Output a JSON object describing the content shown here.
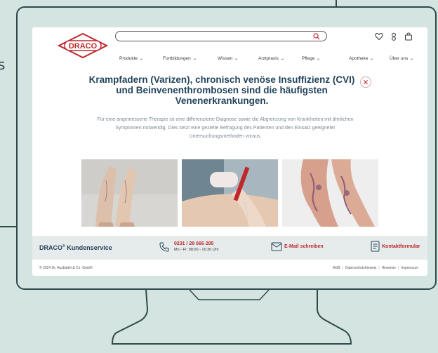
{
  "page": {
    "side_fragment": "s"
  },
  "header": {
    "logo_text": "DRACO",
    "search_placeholder": "",
    "icons": [
      "search-icon",
      "heart-icon",
      "user-icon",
      "bag-icon"
    ]
  },
  "nav": {
    "items": [
      "Produkte",
      "Fortbildungen",
      "Wissen",
      "Arztpraxis",
      "Pflege",
      "Apotheke",
      "Über uns"
    ]
  },
  "content": {
    "title": "Krampfadern (Varizen), chronisch venöse Insuffizienz (CVI) und Beinvenenthrombosen sind die häufigsten Venenerkrankungen.",
    "intro": "Für eine angemessene Therapie ist eine differenzierte Diagnose sowie die Abgrenzung von Krankheiten mit ähnlichen Symptomen notwendig. Dies setzt eine gezielte Befragung des Patienten und den Einsatz geeigneter Untersuchungsmethoden voraus."
  },
  "service": {
    "title": "DRACO",
    "title_mark": "®",
    "title_suffix": " Kundenservice",
    "phone_number": "0231 / 28 666 285",
    "phone_hours": "Mo - Fr: 08:00 - 16:30 Uhr",
    "mail_label": "E-Mail schreiben",
    "form_label": "Kontaktformular"
  },
  "footer": {
    "copyright": "© 2024 Dr. Ausbüttel & Co. GmbH",
    "links": [
      "AGB",
      "Datenschutzhinweis",
      "Hinweise",
      "Impressum"
    ]
  },
  "colors": {
    "accent": "#c0282c",
    "heading": "#23445b",
    "background": "#d3e4e1"
  }
}
